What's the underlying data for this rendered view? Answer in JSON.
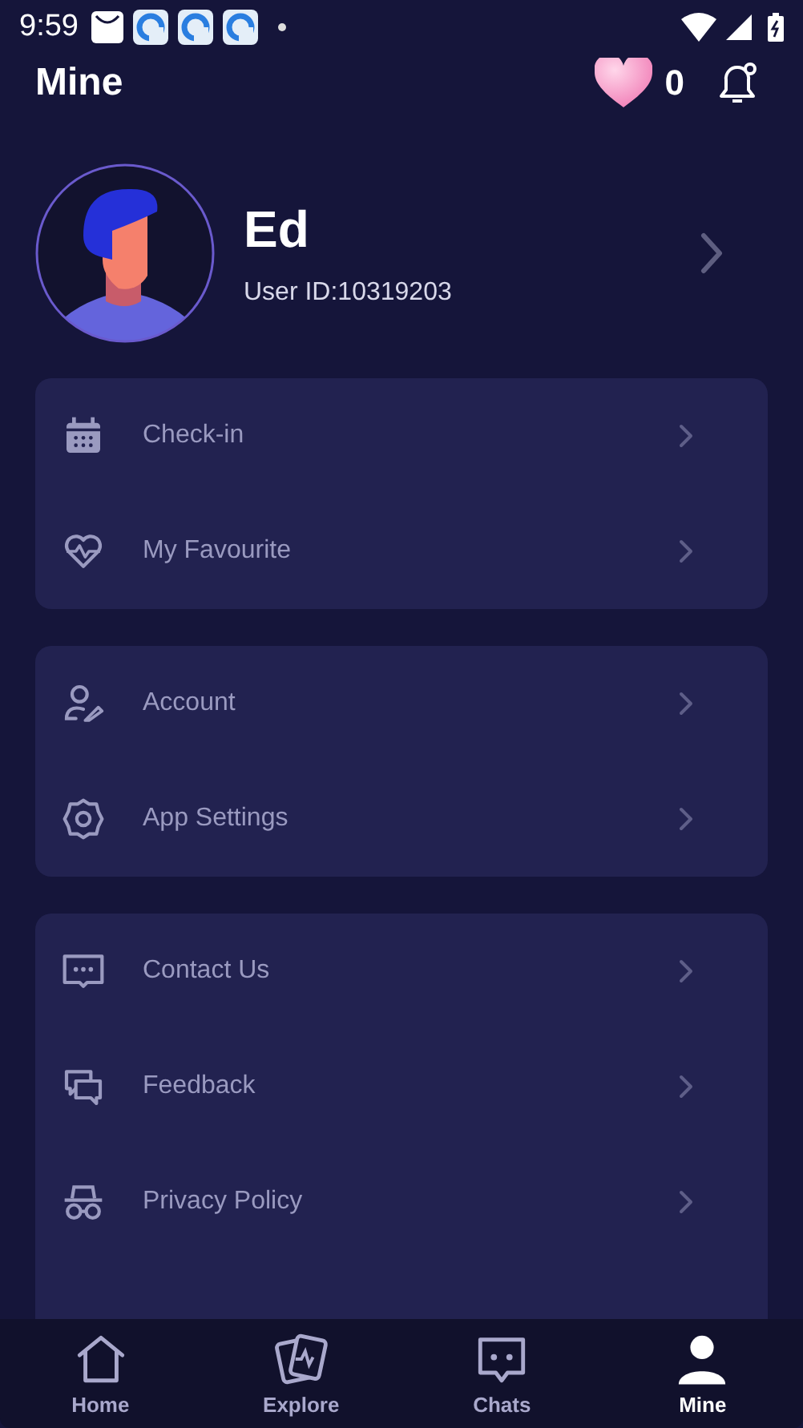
{
  "status_bar": {
    "time": "9:59"
  },
  "header": {
    "title": "Mine",
    "likes": "0"
  },
  "profile": {
    "name": "Ed",
    "user_id": "User ID:10319203"
  },
  "menu_groups": [
    {
      "items": [
        {
          "label": "Check-in"
        },
        {
          "label": "My Favourite"
        }
      ]
    },
    {
      "items": [
        {
          "label": "Account"
        },
        {
          "label": "App Settings"
        }
      ]
    },
    {
      "items": [
        {
          "label": "Contact Us"
        },
        {
          "label": "Feedback"
        },
        {
          "label": "Privacy Policy"
        }
      ]
    }
  ],
  "nav": [
    {
      "label": "Home",
      "selected": false
    },
    {
      "label": "Explore",
      "selected": false
    },
    {
      "label": "Chats",
      "selected": false
    },
    {
      "label": "Mine",
      "selected": true
    }
  ]
}
